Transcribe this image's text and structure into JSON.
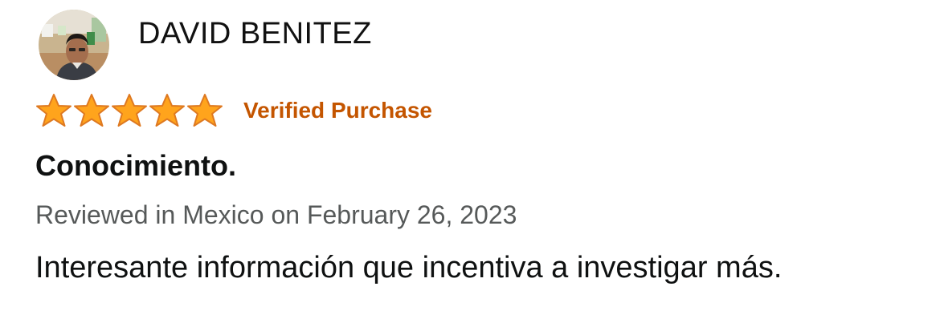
{
  "review": {
    "reviewer_name": "DAVID BENITEZ",
    "avatar_icon": "reviewer-profile-photo",
    "rating": 5,
    "rating_max": 5,
    "star_icon": "star-filled-icon",
    "verified_label": "Verified Purchase",
    "title": "Conocimiento.",
    "meta": "Reviewed in Mexico on February 26, 2023",
    "body": "Interesante información que incentiva a investigar más."
  },
  "colors": {
    "star_fill": "#ffa41c",
    "star_stroke": "#de7921",
    "verified": "#c45500",
    "meta_text": "#565959",
    "body_text": "#0f1111"
  }
}
